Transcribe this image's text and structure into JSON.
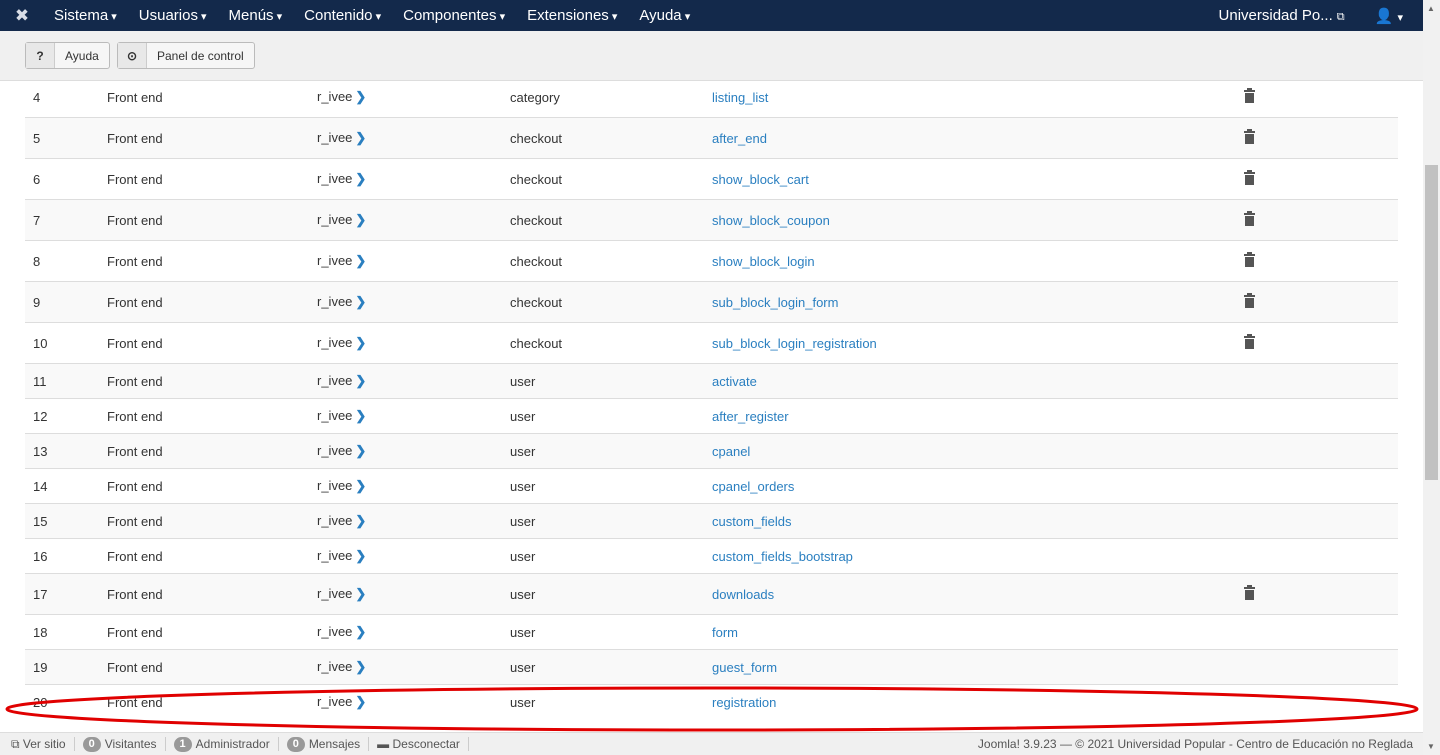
{
  "nav": {
    "menu": [
      "Sistema",
      "Usuarios",
      "Menús",
      "Contenido",
      "Componentes",
      "Extensiones",
      "Ayuda"
    ],
    "site": "Universidad Po...",
    "user_icon": "user-icon"
  },
  "toolbar": {
    "help": "Ayuda",
    "cpanel": "Panel de control"
  },
  "rows": [
    {
      "id": "4",
      "location": "Front end",
      "template": "r_ivee",
      "view": "category",
      "file": "listing_list",
      "trash": true
    },
    {
      "id": "5",
      "location": "Front end",
      "template": "r_ivee",
      "view": "checkout",
      "file": "after_end",
      "trash": true
    },
    {
      "id": "6",
      "location": "Front end",
      "template": "r_ivee",
      "view": "checkout",
      "file": "show_block_cart",
      "trash": true
    },
    {
      "id": "7",
      "location": "Front end",
      "template": "r_ivee",
      "view": "checkout",
      "file": "show_block_coupon",
      "trash": true
    },
    {
      "id": "8",
      "location": "Front end",
      "template": "r_ivee",
      "view": "checkout",
      "file": "show_block_login",
      "trash": true
    },
    {
      "id": "9",
      "location": "Front end",
      "template": "r_ivee",
      "view": "checkout",
      "file": "sub_block_login_form",
      "trash": true
    },
    {
      "id": "10",
      "location": "Front end",
      "template": "r_ivee",
      "view": "checkout",
      "file": "sub_block_login_registration",
      "trash": true
    },
    {
      "id": "11",
      "location": "Front end",
      "template": "r_ivee",
      "view": "user",
      "file": "activate",
      "trash": false
    },
    {
      "id": "12",
      "location": "Front end",
      "template": "r_ivee",
      "view": "user",
      "file": "after_register",
      "trash": false
    },
    {
      "id": "13",
      "location": "Front end",
      "template": "r_ivee",
      "view": "user",
      "file": "cpanel",
      "trash": false
    },
    {
      "id": "14",
      "location": "Front end",
      "template": "r_ivee",
      "view": "user",
      "file": "cpanel_orders",
      "trash": false
    },
    {
      "id": "15",
      "location": "Front end",
      "template": "r_ivee",
      "view": "user",
      "file": "custom_fields",
      "trash": false
    },
    {
      "id": "16",
      "location": "Front end",
      "template": "r_ivee",
      "view": "user",
      "file": "custom_fields_bootstrap",
      "trash": false
    },
    {
      "id": "17",
      "location": "Front end",
      "template": "r_ivee",
      "view": "user",
      "file": "downloads",
      "trash": true
    },
    {
      "id": "18",
      "location": "Front end",
      "template": "r_ivee",
      "view": "user",
      "file": "form",
      "trash": false
    },
    {
      "id": "19",
      "location": "Front end",
      "template": "r_ivee",
      "view": "user",
      "file": "guest_form",
      "trash": false
    },
    {
      "id": "20",
      "location": "Front end",
      "template": "r_ivee",
      "view": "user",
      "file": "registration",
      "trash": false
    }
  ],
  "status": {
    "view_site": "Ver sitio",
    "visitors_count": "0",
    "visitors": "Visitantes",
    "admin_count": "1",
    "admin": "Administrador",
    "messages_count": "0",
    "messages": "Mensajes",
    "logout": "Desconectar",
    "footer": "Joomla! 3.9.23  —  © 2021 Universidad Popular - Centro de Educación no Reglada"
  },
  "colors": {
    "navbar": "#13294b",
    "link": "#2a7fc0",
    "highlight": "#e00000"
  }
}
